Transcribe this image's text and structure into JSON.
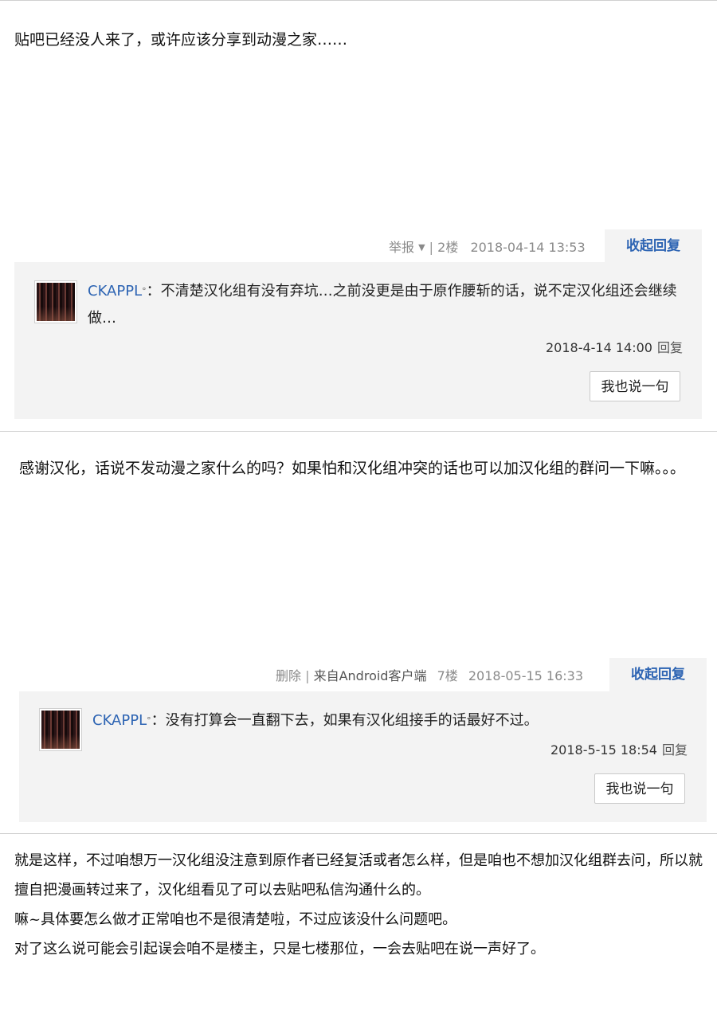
{
  "post1": {
    "text": "贴吧已经没人来了，或许应该分享到动漫之家……",
    "report": "举报",
    "floor": "2楼",
    "time": "2018-04-14 13:53",
    "collapse": "收起回复",
    "reply": {
      "user": "CKAPPL",
      "badge": "°",
      "text": "：不清楚汉化组有没有弃坑…之前没更是由于原作腰斩的话，说不定汉化组还会继续做…",
      "time": "2018-4-14 14:00",
      "reply_label": "回复"
    },
    "say_button": "我也说一句"
  },
  "post2": {
    "text": "感谢汉化，话说不发动漫之家什么的吗？如果怕和汉化组冲突的话也可以加汉化组的群问一下嘛。。。",
    "delete": "删除",
    "source": "来自Android客户端",
    "floor": "7楼",
    "time": "2018-05-15 16:33",
    "collapse": "收起回复",
    "reply": {
      "user": "CKAPPL",
      "badge": "°",
      "text": "：没有打算会一直翻下去，如果有汉化组接手的话最好不过。",
      "time": "2018-5-15 18:54",
      "reply_label": "回复"
    },
    "say_button": "我也说一句"
  },
  "post3": {
    "lines": [
      "就是这样，不过咱想万一汉化组没注意到原作者已经复活或者怎么样，但是咱也不想加汉化组群去问，所以就擅自把漫画转过来了，汉化组看见了可以去贴吧私信沟通什么的。",
      "嘛~具体要怎么做才正常咱也不是很清楚啦，不过应该没什么问题吧。",
      "对了这么说可能会引起误会咱不是楼主，只是七楼那位，一会去贴吧在说一声好了。"
    ]
  }
}
